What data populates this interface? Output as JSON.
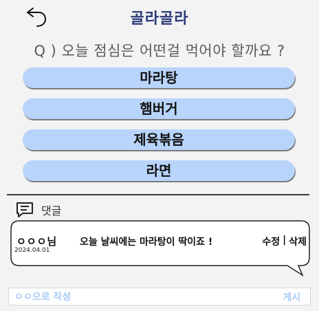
{
  "header": {
    "title": "골라골라",
    "back_icon": "undo-arrow-icon"
  },
  "question": "Q ) 오늘 점심은 어떤걸 먹어야 할까요 ?",
  "options": [
    {
      "label": "마라탕"
    },
    {
      "label": "햄버거"
    },
    {
      "label": "제육볶음"
    },
    {
      "label": "라면"
    }
  ],
  "comments_section": {
    "label": "댓글",
    "icon": "chat-bubble-icon"
  },
  "comment": {
    "author": "ㅇㅇㅇ님",
    "date": "2024.04.01",
    "text": "오늘 날씨에는 마라탕이 딱이죠 !",
    "edit_label": "수정",
    "separator": "|",
    "delete_label": "삭제"
  },
  "comment_input": {
    "placeholder": "ㅇㅇ으로 작성",
    "submit_label": "게시"
  },
  "colors": {
    "title": "#2b3a7a",
    "option_bg": "#b9d4fb",
    "input_accent": "#a9cbf6"
  }
}
